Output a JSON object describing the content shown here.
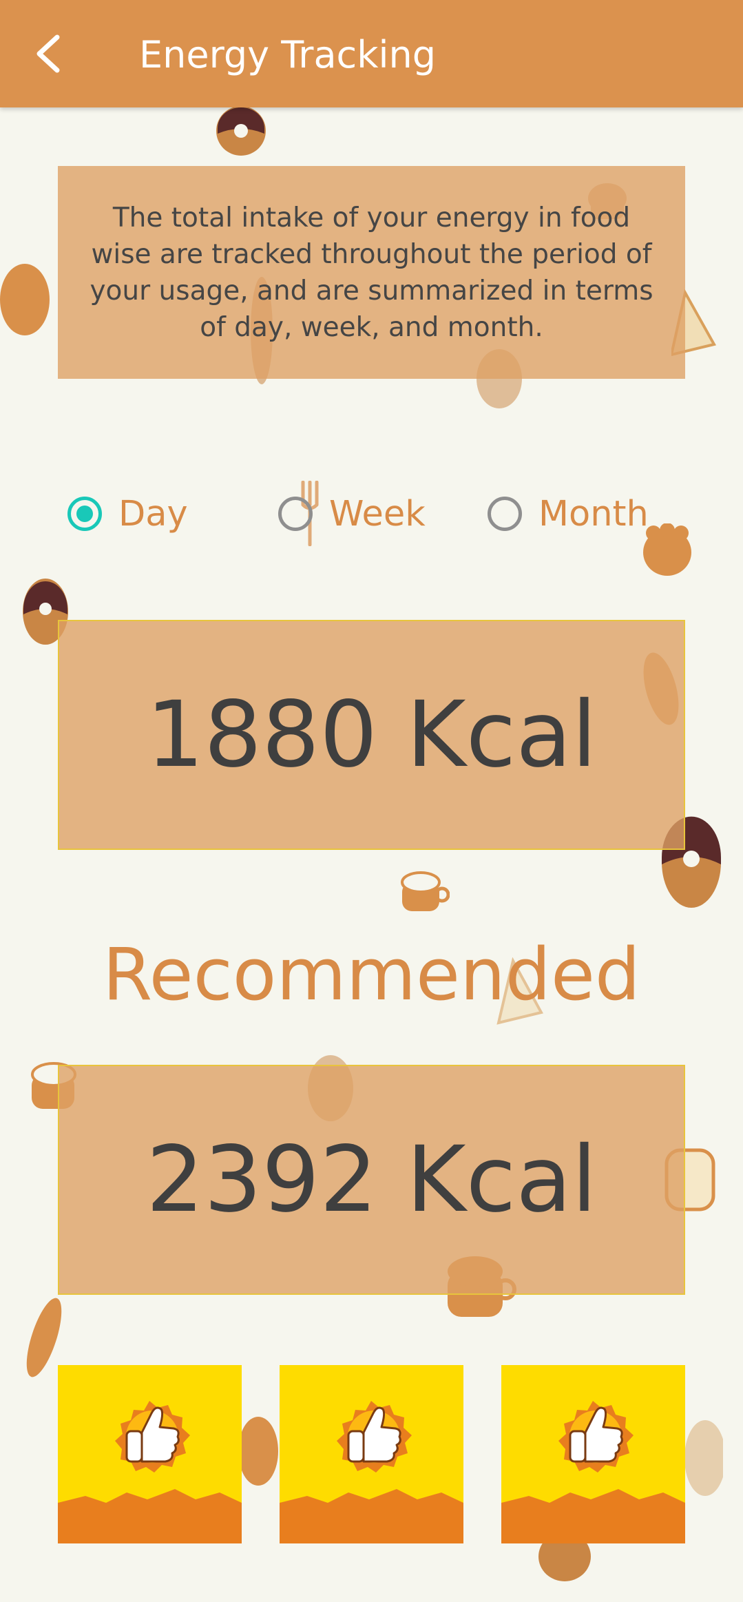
{
  "appbar": {
    "title": "Energy Tracking",
    "back_icon": "chevron-left-icon"
  },
  "info": {
    "text": "The total intake of your energy in food wise are tracked throughout the period of your usage, and are summarized in terms of day, week, and month."
  },
  "period": {
    "options": [
      {
        "label": "Day",
        "selected": true
      },
      {
        "label": "Week",
        "selected": false
      },
      {
        "label": "Month",
        "selected": false
      }
    ]
  },
  "intake": {
    "value_text": "1880 Kcal"
  },
  "recommended": {
    "title": "Recommended",
    "value_text": "2392 Kcal"
  },
  "badges": [
    {
      "icon": "thumbs-up-icon"
    },
    {
      "icon": "thumbs-up-icon"
    },
    {
      "icon": "thumbs-up-icon"
    }
  ],
  "colors": {
    "appbar": "#db924e",
    "background": "#f6f6ee",
    "box": "#dea064",
    "accent_radio": "#19c8b8",
    "label_orange": "#d88b47",
    "badge_yellow": "#fedc00",
    "badge_orange": "#e87e1e"
  }
}
